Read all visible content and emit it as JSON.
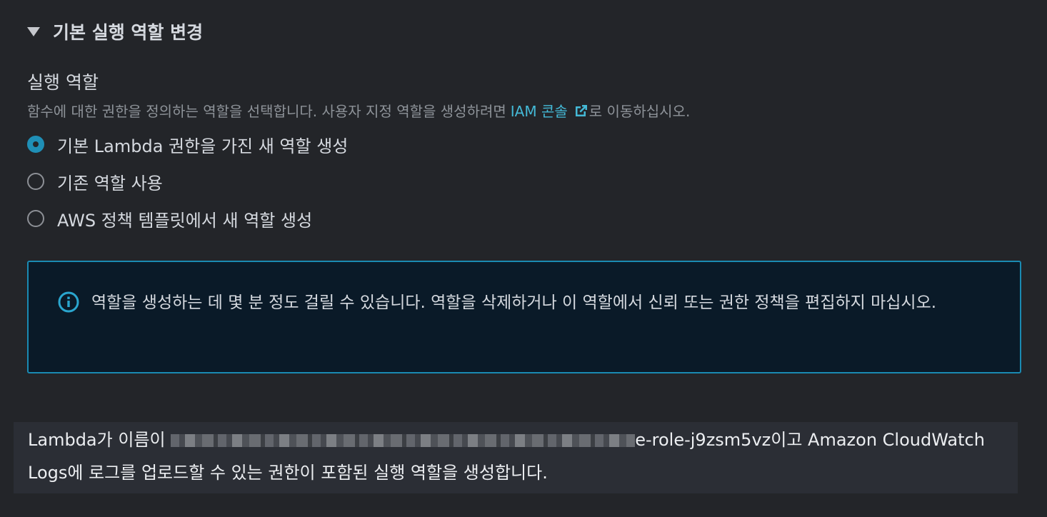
{
  "section": {
    "title": "기본 실행 역할 변경"
  },
  "field": {
    "label": "실행 역할",
    "description_before": "함수에 대한 권한을 정의하는 역할을 선택합니다. 사용자 지정 역할을 생성하려면",
    "link_text": "IAM 콘솔",
    "description_after": "로 이동하십시오."
  },
  "radio_options": [
    {
      "label": "기본 Lambda 권한을 가진 새 역할 생성",
      "selected": true
    },
    {
      "label": "기존 역할 사용",
      "selected": false
    },
    {
      "label": "AWS 정책 템플릿에서 새 역할 생성",
      "selected": false
    }
  ],
  "info": {
    "icon": "info-circle-icon",
    "text": "역할을 생성하는 데 몇 분 정도 걸릴 수 있습니다. 역할을 삭제하거나 이 역할에서 신뢰 또는 권한 정책을 편집하지 마십시오."
  },
  "summary": {
    "prefix": "Lambda가 이름이 ",
    "role_suffix": "e-role-j9zsm5vz",
    "suffix": "이고 Amazon CloudWatch Logs에 로그를 업로드할 수 있는 권한이 포함된 실행 역할을 생성합니다."
  },
  "colors": {
    "background": "#232529",
    "accent": "#1f8fb6",
    "link": "#44b9d6",
    "info_border": "#1a8ab2",
    "info_background": "#0a1a28"
  }
}
